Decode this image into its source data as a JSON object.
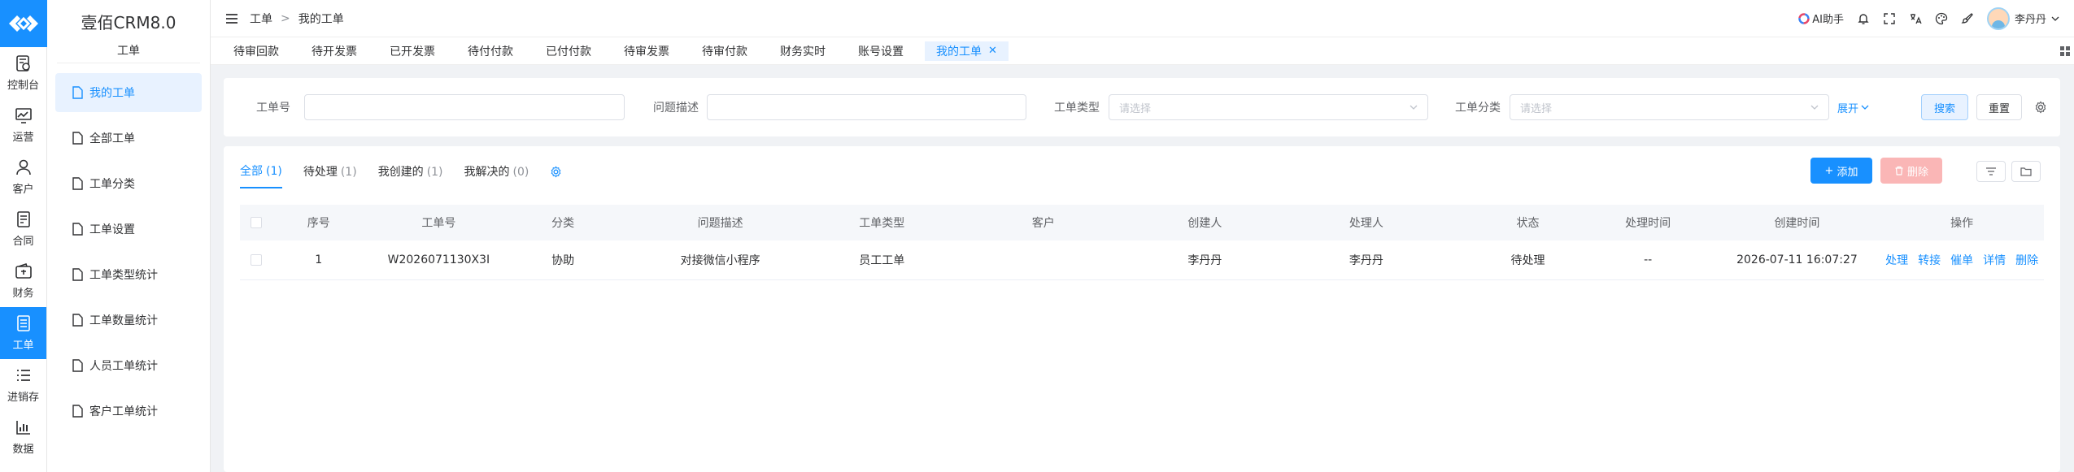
{
  "app": {
    "title": "壹佰CRM8.0",
    "brand_color": "#1890ff"
  },
  "rail": [
    {
      "label": "控制台",
      "icon": "dashboard-icon"
    },
    {
      "label": "运营",
      "icon": "operations-chart-icon"
    },
    {
      "label": "客户",
      "icon": "customer-icon"
    },
    {
      "label": "合同",
      "icon": "contract-icon"
    },
    {
      "label": "财务",
      "icon": "wallet-icon"
    },
    {
      "label": "工单",
      "icon": "ticket-icon",
      "active": true
    },
    {
      "label": "进销存",
      "icon": "inventory-list-icon"
    },
    {
      "label": "数据",
      "icon": "data-chart-icon"
    }
  ],
  "submenu": {
    "group": "工单",
    "items": [
      {
        "label": "我的工单",
        "active": true
      },
      {
        "label": "全部工单"
      },
      {
        "label": "工单分类"
      },
      {
        "label": "工单设置"
      },
      {
        "label": "工单类型统计"
      },
      {
        "label": "工单数量统计"
      },
      {
        "label": "人员工单统计"
      },
      {
        "label": "客户工单统计"
      }
    ]
  },
  "breadcrumb": {
    "root": "工单",
    "separator": ">",
    "current": "我的工单"
  },
  "header": {
    "ai_label": "AI助手",
    "user_name": "李丹丹"
  },
  "tabs": [
    {
      "label": "待审回款"
    },
    {
      "label": "待开发票"
    },
    {
      "label": "已开发票"
    },
    {
      "label": "待付付款"
    },
    {
      "label": "已付付款"
    },
    {
      "label": "待审发票"
    },
    {
      "label": "待审付款"
    },
    {
      "label": "财务实时"
    },
    {
      "label": "账号设置"
    },
    {
      "label": "我的工单",
      "active": true,
      "closable": true
    }
  ],
  "filters": {
    "ticket_no_label": "工单号",
    "desc_label": "问题描述",
    "type_label": "工单类型",
    "type_placeholder": "请选择",
    "category_label": "工单分类",
    "category_placeholder": "请选择",
    "expand_label": "展开",
    "search_label": "搜索",
    "reset_label": "重置"
  },
  "subtabs": [
    {
      "label": "全部",
      "count": "(1)",
      "active": true
    },
    {
      "label": "待处理",
      "count": "(1)"
    },
    {
      "label": "我创建的",
      "count": "(1)"
    },
    {
      "label": "我解决的",
      "count": "(0)"
    }
  ],
  "actions": {
    "add_label": "添加",
    "delete_label": "删除"
  },
  "table": {
    "columns": [
      "序号",
      "工单号",
      "分类",
      "问题描述",
      "工单类型",
      "客户",
      "创建人",
      "处理人",
      "状态",
      "处理时间",
      "创建时间",
      "操作"
    ],
    "rows": [
      {
        "index": "1",
        "ticket_no": "W2026071130X3I",
        "category": "协助",
        "description": "对接微信小程序",
        "type": "员工工单",
        "customer": "",
        "creator": "李丹丹",
        "handler": "李丹丹",
        "status": "待处理",
        "handled_time": "--",
        "created_time": "2026-07-11 16:07:27",
        "ops": [
          "处理",
          "转接",
          "催单",
          "详情",
          "删除"
        ]
      }
    ]
  }
}
